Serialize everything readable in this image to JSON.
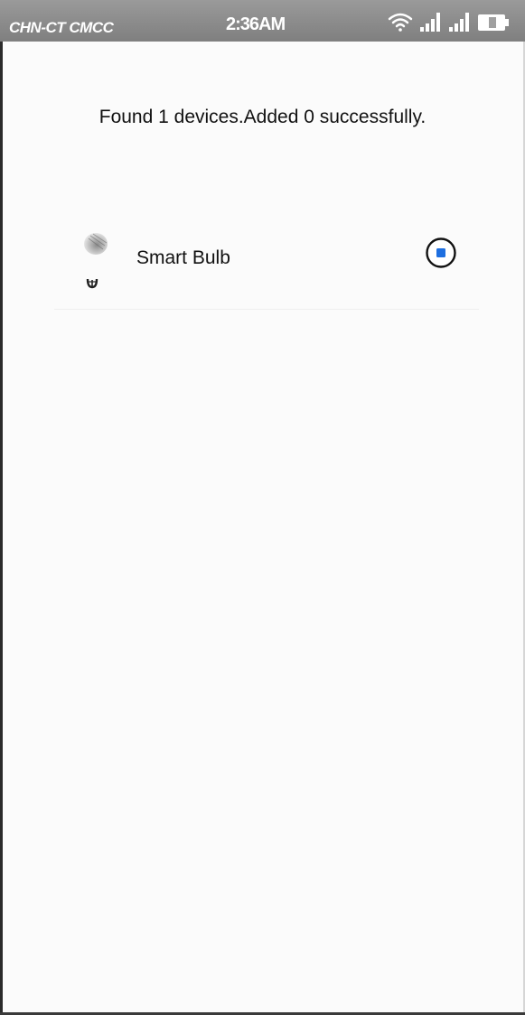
{
  "status_bar": {
    "carrier": "CHN-CT CMCC",
    "time": "2:36AM",
    "icons": [
      "wifi-icon",
      "signal-icon",
      "signal-icon",
      "battery-icon"
    ]
  },
  "summary": {
    "text": "Found 1 devices.Added 0 successfully."
  },
  "devices": [
    {
      "name": "Smart Bulb",
      "icon": "smart-bulb-icon",
      "selected": true
    }
  ],
  "colors": {
    "accent": "#1e6fe0",
    "status_bar": "#8c8c8c",
    "background": "#fbfbfb",
    "text": "#111111"
  }
}
